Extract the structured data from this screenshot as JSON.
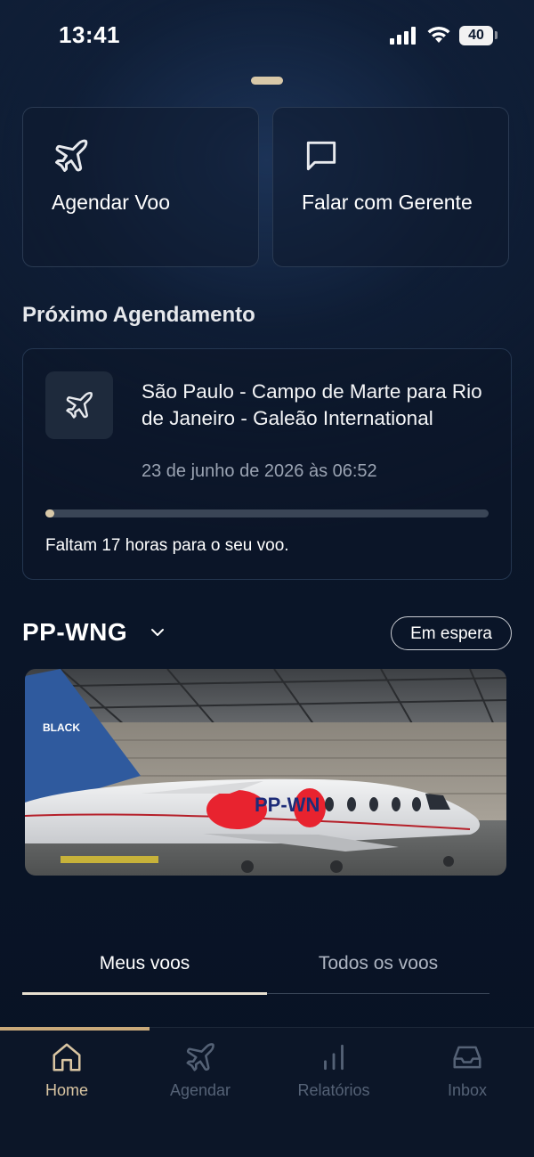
{
  "status_bar": {
    "time": "13:41",
    "battery": "40"
  },
  "actions": [
    {
      "label": "Agendar Voo",
      "icon": "airplane-icon"
    },
    {
      "label": "Falar com Gerente",
      "icon": "chat-bubble-icon"
    }
  ],
  "next_booking": {
    "section_title": "Próximo Agendamento",
    "route": "São Paulo - Campo de Marte para Rio de Janeiro - Galeão International",
    "datetime": "23 de junho de 2026 às 06:52",
    "progress_percent": 2,
    "remaining_text": "Faltam 17 horas para o seu voo."
  },
  "aircraft": {
    "tail_number": "PP-WNG",
    "status": "Em espera",
    "livery_text": "BLACK",
    "fuselage_text": "PP-WN"
  },
  "tabs": [
    {
      "label": "Meus voos",
      "active": true
    },
    {
      "label": "Todos os voos",
      "active": false
    }
  ],
  "bottom_nav": [
    {
      "label": "Home",
      "icon": "home-icon",
      "active": true
    },
    {
      "label": "Agendar",
      "icon": "airplane-icon",
      "active": false
    },
    {
      "label": "Relatórios",
      "icon": "bar-chart-icon",
      "active": false
    },
    {
      "label": "Inbox",
      "icon": "inbox-icon",
      "active": false
    }
  ],
  "colors": {
    "accent": "#d8c8a8",
    "nav_active": "#d9c5a2",
    "nav_inactive": "#556276",
    "background": "#0b1629"
  }
}
